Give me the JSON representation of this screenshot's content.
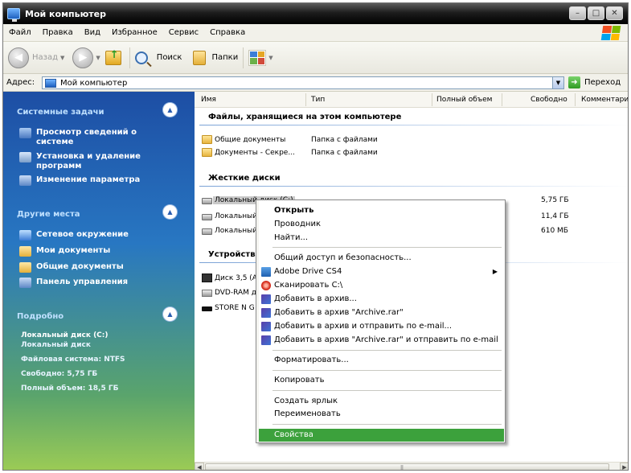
{
  "window": {
    "title": "Мой компьютер",
    "buttons": {
      "minimize": "–",
      "maximize": "□",
      "close": "✕"
    }
  },
  "menubar": [
    "Файл",
    "Правка",
    "Вид",
    "Избранное",
    "Сервис",
    "Справка"
  ],
  "toolbar": {
    "back_label": "Назад",
    "search_label": "Поиск",
    "folders_label": "Папки"
  },
  "address": {
    "label": "Адрес:",
    "value": "Мой компьютер",
    "go_label": "Переход"
  },
  "left_panel": {
    "system_tasks": {
      "title": "Системные задачи",
      "items": [
        "Просмотр сведений о системе",
        "Установка и удаление программ",
        "Изменение параметра"
      ]
    },
    "other_places": {
      "title": "Другие места",
      "items": [
        "Сетевое окружение",
        "Мои документы",
        "Общие документы",
        "Панель управления"
      ]
    },
    "details": {
      "title": "Подробно",
      "name": "Локальный диск (C:)",
      "type": "Локальный диск",
      "fs": "Файловая система: NTFS",
      "free": "Свободно: 5,75 ГБ",
      "total": "Полный объем: 18,5 ГБ"
    }
  },
  "columns": {
    "name": "Имя",
    "type": "Тип",
    "total": "Полный объем",
    "free": "Свободно",
    "comments": "Комментари"
  },
  "groups": {
    "stored_files": "Файлы, хранящиеся на этом компьютере",
    "hard_disks": "Жесткие диски",
    "removable": "Устройства"
  },
  "rows": {
    "shared_docs": {
      "name": "Общие документы",
      "type": "Папка с файлами"
    },
    "private_docs": {
      "name": "Документы - Секре...",
      "type": "Папка с файлами"
    },
    "disk_c": {
      "name": "Локальный диск (C:)",
      "free": "5,75 ГБ"
    },
    "disk_2": {
      "name": "Локальный",
      "free": "11,4 ГБ"
    },
    "disk_3": {
      "name": "Локальный",
      "free": "610 МБ"
    },
    "floppy": {
      "name": "Диск 3,5 (A"
    },
    "dvd": {
      "name": "DVD-RAM д"
    },
    "usb": {
      "name": "STORE N G"
    }
  },
  "context_menu": {
    "open": "Открыть",
    "explorer": "Проводник",
    "find": "Найти...",
    "sharing": "Общий доступ и безопасность...",
    "adobe": "Adobe Drive CS4",
    "scan": "Сканировать C:\\",
    "add_archive": "Добавить в архив...",
    "add_archive_rar": "Добавить в архив \"Archive.rar\"",
    "add_archive_email": "Добавить в архив и отправить по e-mail...",
    "add_archive_rar_email": "Добавить в архив \"Archive.rar\" и отправить по e-mail",
    "format": "Форматировать...",
    "copy": "Копировать",
    "shortcut": "Создать ярлык",
    "rename": "Переименовать",
    "properties": "Свойства"
  },
  "colors": {
    "left_panel_top": "#1d4ea4",
    "left_panel_bottom": "#9ccc55",
    "highlight": "#3ca13c"
  }
}
